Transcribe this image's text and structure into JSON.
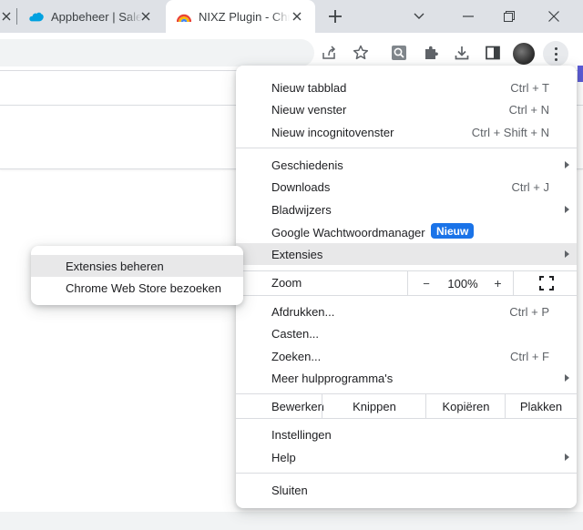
{
  "tabs": [
    {
      "title": "Appbeheer | Sales",
      "favicon": "salesforce-cloud-icon"
    },
    {
      "title": "NIXZ Plugin - Chrome",
      "favicon": "chrome-webstore-rainbow-icon"
    }
  ],
  "colors": {
    "tabstrip": "#dee1e6",
    "accent": "#1a73e8",
    "highlight": "#e8e8e9",
    "side_accent": "#5b5bd6"
  },
  "toolbar": {
    "icons": [
      "share-icon",
      "bookmark-star-icon",
      "search-extension-icon",
      "extensions-puzzle-icon",
      "download-icon",
      "side-panel-icon",
      "profile-avatar",
      "more-menu-icon"
    ]
  },
  "menu": {
    "group1": [
      {
        "label": "Nieuw tabblad",
        "shortcut": "Ctrl + T"
      },
      {
        "label": "Nieuw venster",
        "shortcut": "Ctrl + N"
      },
      {
        "label": "Nieuw incognitovenster",
        "shortcut": "Ctrl + Shift + N"
      }
    ],
    "group2": [
      {
        "label": "Geschiedenis",
        "shortcut": ""
      },
      {
        "label": "Downloads",
        "shortcut": "Ctrl + J"
      },
      {
        "label": "Bladwijzers",
        "shortcut": ""
      },
      {
        "label": "Google Wachtwoordmanager",
        "badge": "Nieuw"
      },
      {
        "label": "Extensies",
        "shortcut": ""
      }
    ],
    "zoom": {
      "label": "Zoom",
      "minus": "−",
      "value": "100%",
      "plus": "+"
    },
    "group3": [
      {
        "label": "Afdrukken...",
        "shortcut": "Ctrl + P"
      },
      {
        "label": "Casten...",
        "shortcut": ""
      },
      {
        "label": "Zoeken...",
        "shortcut": "Ctrl + F"
      },
      {
        "label": "Meer hulpprogramma's",
        "shortcut": ""
      }
    ],
    "edit": {
      "label": "Bewerken",
      "cut": "Knippen",
      "copy": "Kopiëren",
      "paste": "Plakken"
    },
    "group4": [
      {
        "label": "Instellingen"
      },
      {
        "label": "Help"
      }
    ],
    "exit": {
      "label": "Sluiten"
    }
  },
  "submenu": {
    "items": [
      {
        "label": "Extensies beheren"
      },
      {
        "label": "Chrome Web Store bezoeken"
      }
    ]
  }
}
